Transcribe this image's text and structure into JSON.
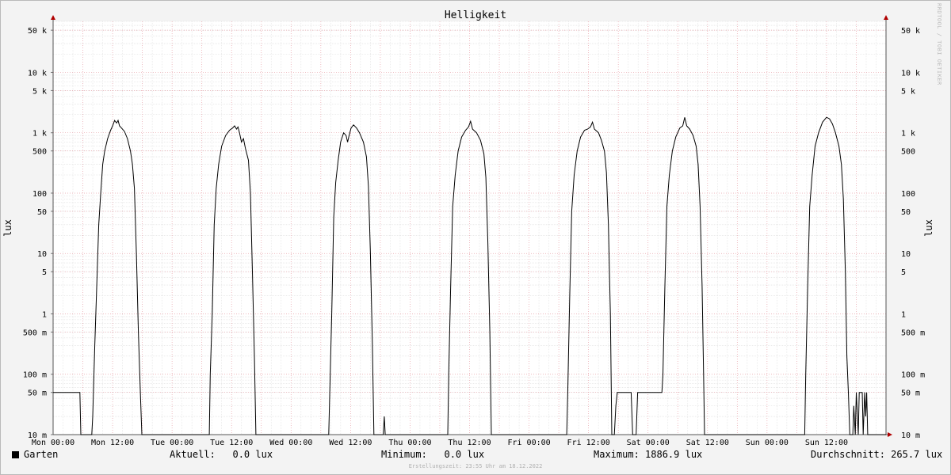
{
  "chart_data": {
    "type": "line",
    "title": "Helligkeit",
    "ylabel": "lux",
    "y_scale": "log",
    "ylim": [
      0.01,
      70000
    ],
    "y_ticks": [
      {
        "value": 0.01,
        "label": "10 m"
      },
      {
        "value": 0.05,
        "label": "50 m"
      },
      {
        "value": 0.1,
        "label": "100 m"
      },
      {
        "value": 0.5,
        "label": "500 m"
      },
      {
        "value": 1,
        "label": "1"
      },
      {
        "value": 5,
        "label": "5"
      },
      {
        "value": 10,
        "label": "10"
      },
      {
        "value": 50,
        "label": "50"
      },
      {
        "value": 100,
        "label": "100"
      },
      {
        "value": 500,
        "label": "500"
      },
      {
        "value": 1000,
        "label": "1 k"
      },
      {
        "value": 5000,
        "label": "5 k"
      },
      {
        "value": 10000,
        "label": "10 k"
      },
      {
        "value": 50000,
        "label": "50 k"
      }
    ],
    "xlim": [
      0,
      168
    ],
    "x_ticks": [
      {
        "value": 0,
        "label": "Mon 00:00"
      },
      {
        "value": 12,
        "label": "Mon 12:00"
      },
      {
        "value": 24,
        "label": "Tue 00:00"
      },
      {
        "value": 36,
        "label": "Tue 12:00"
      },
      {
        "value": 48,
        "label": "Wed 00:00"
      },
      {
        "value": 60,
        "label": "Wed 12:00"
      },
      {
        "value": 72,
        "label": "Thu 00:00"
      },
      {
        "value": 84,
        "label": "Thu 12:00"
      },
      {
        "value": 96,
        "label": "Fri 00:00"
      },
      {
        "value": 108,
        "label": "Fri 12:00"
      },
      {
        "value": 120,
        "label": "Sat 00:00"
      },
      {
        "value": 132,
        "label": "Sat 12:00"
      },
      {
        "value": 144,
        "label": "Sun 00:00"
      },
      {
        "value": 156,
        "label": "Sun 12:00"
      }
    ],
    "grid": true,
    "series": [
      {
        "name": "Garten",
        "color": "#000000",
        "points": [
          [
            0,
            0.05
          ],
          [
            5.4,
            0.05
          ],
          [
            5.6,
            0.01
          ],
          [
            7.8,
            0.01
          ],
          [
            8,
            0.02
          ],
          [
            8.4,
            0.3
          ],
          [
            8.8,
            3
          ],
          [
            9.2,
            30
          ],
          [
            9.6,
            100
          ],
          [
            10,
            300
          ],
          [
            10.4,
            500
          ],
          [
            11,
            800
          ],
          [
            11.6,
            1100
          ],
          [
            12,
            1300
          ],
          [
            12.4,
            1600
          ],
          [
            12.8,
            1450
          ],
          [
            13.1,
            1600
          ],
          [
            13.4,
            1300
          ],
          [
            13.8,
            1200
          ],
          [
            14.4,
            1050
          ],
          [
            15,
            800
          ],
          [
            15.6,
            500
          ],
          [
            16,
            300
          ],
          [
            16.4,
            120
          ],
          [
            16.8,
            10
          ],
          [
            17.2,
            0.5
          ],
          [
            17.6,
            0.05
          ],
          [
            17.9,
            0.01
          ],
          [
            31.5,
            0.01
          ],
          [
            31.7,
            0.1
          ],
          [
            32.1,
            1
          ],
          [
            32.5,
            30
          ],
          [
            32.9,
            120
          ],
          [
            33.4,
            300
          ],
          [
            34,
            600
          ],
          [
            34.8,
            900
          ],
          [
            35.6,
            1100
          ],
          [
            36.2,
            1200
          ],
          [
            36.6,
            1300
          ],
          [
            37,
            1150
          ],
          [
            37.3,
            1250
          ],
          [
            37.6,
            1000
          ],
          [
            38,
            700
          ],
          [
            38.4,
            800
          ],
          [
            38.8,
            550
          ],
          [
            39.4,
            350
          ],
          [
            39.8,
            100
          ],
          [
            40.2,
            5
          ],
          [
            40.6,
            0.2
          ],
          [
            40.9,
            0.01
          ],
          [
            55.6,
            0.01
          ],
          [
            55.8,
            0.05
          ],
          [
            56.2,
            1
          ],
          [
            56.6,
            40
          ],
          [
            57,
            150
          ],
          [
            57.5,
            350
          ],
          [
            58,
            700
          ],
          [
            58.6,
            1000
          ],
          [
            59.1,
            900
          ],
          [
            59.4,
            700
          ],
          [
            59.7,
            900
          ],
          [
            60.1,
            1200
          ],
          [
            60.6,
            1350
          ],
          [
            61.2,
            1200
          ],
          [
            61.8,
            1000
          ],
          [
            62.6,
            700
          ],
          [
            63.2,
            400
          ],
          [
            63.6,
            130
          ],
          [
            64,
            10
          ],
          [
            64.4,
            0.3
          ],
          [
            64.7,
            0.01
          ],
          [
            66.6,
            0.01
          ],
          [
            66.8,
            0.02
          ],
          [
            67,
            0.01
          ],
          [
            79.6,
            0.01
          ],
          [
            79.8,
            0.1
          ],
          [
            80.2,
            3
          ],
          [
            80.6,
            60
          ],
          [
            81.1,
            200
          ],
          [
            81.7,
            500
          ],
          [
            82.4,
            850
          ],
          [
            83.2,
            1100
          ],
          [
            83.8,
            1250
          ],
          [
            84.2,
            1550
          ],
          [
            84.6,
            1150
          ],
          [
            85.4,
            1000
          ],
          [
            86.2,
            750
          ],
          [
            86.9,
            450
          ],
          [
            87.3,
            180
          ],
          [
            87.7,
            15
          ],
          [
            88.1,
            0.5
          ],
          [
            88.4,
            0.01
          ],
          [
            103.6,
            0.01
          ],
          [
            103.8,
            0.05
          ],
          [
            104.2,
            2
          ],
          [
            104.6,
            50
          ],
          [
            105.1,
            200
          ],
          [
            105.7,
            500
          ],
          [
            106.4,
            850
          ],
          [
            107.2,
            1100
          ],
          [
            107.8,
            1150
          ],
          [
            108.4,
            1250
          ],
          [
            108.8,
            1500
          ],
          [
            109.2,
            1150
          ],
          [
            110,
            1000
          ],
          [
            110.6,
            750
          ],
          [
            111.2,
            500
          ],
          [
            111.6,
            220
          ],
          [
            112,
            30
          ],
          [
            112.4,
            1
          ],
          [
            112.7,
            0.01
          ],
          [
            113.2,
            0.01
          ],
          [
            113.5,
            0.03
          ],
          [
            113.8,
            0.05
          ],
          [
            116.6,
            0.05
          ],
          [
            116.9,
            0.01
          ],
          [
            117.6,
            0.01
          ],
          [
            117.9,
            0.05
          ],
          [
            122.8,
            0.05
          ],
          [
            123,
            0.1
          ],
          [
            123.4,
            3
          ],
          [
            123.8,
            60
          ],
          [
            124.3,
            200
          ],
          [
            124.9,
            500
          ],
          [
            125.6,
            850
          ],
          [
            126.4,
            1200
          ],
          [
            127,
            1300
          ],
          [
            127.4,
            1800
          ],
          [
            127.8,
            1300
          ],
          [
            128.4,
            1150
          ],
          [
            129.1,
            900
          ],
          [
            129.7,
            600
          ],
          [
            130.1,
            300
          ],
          [
            130.5,
            60
          ],
          [
            130.9,
            3
          ],
          [
            131.2,
            0.1
          ],
          [
            131.4,
            0.01
          ],
          [
            151.6,
            0.01
          ],
          [
            151.8,
            0.1
          ],
          [
            152.2,
            3
          ],
          [
            152.6,
            60
          ],
          [
            153.1,
            200
          ],
          [
            153.7,
            600
          ],
          [
            154.4,
            1000
          ],
          [
            155.2,
            1500
          ],
          [
            156,
            1800
          ],
          [
            156.6,
            1700
          ],
          [
            157.2,
            1400
          ],
          [
            157.8,
            1000
          ],
          [
            158.5,
            600
          ],
          [
            159,
            300
          ],
          [
            159.4,
            80
          ],
          [
            159.8,
            5
          ],
          [
            160.1,
            0.2
          ],
          [
            160.4,
            0.05
          ],
          [
            160.7,
            0.01
          ],
          [
            161.3,
            0.01
          ],
          [
            161.5,
            0.03
          ],
          [
            161.8,
            0.01
          ],
          [
            162,
            0.05
          ],
          [
            162.4,
            0.01
          ],
          [
            162.6,
            0.05
          ],
          [
            163.2,
            0.05
          ],
          [
            163.4,
            0.01
          ],
          [
            163.7,
            0.05
          ],
          [
            163.9,
            0.02
          ],
          [
            164.1,
            0.05
          ],
          [
            164.3,
            0.01
          ],
          [
            168,
            0.01
          ]
        ]
      }
    ]
  },
  "legend": {
    "series_name": "Garten",
    "current": "Aktuell:   0.0 lux",
    "minimum": "Minimum:   0.0 lux",
    "maximum": "Maximum: 1886.9 lux",
    "average": "Durchschnitt: 265.7 lux"
  },
  "footer": "Erstellungszeit: 23:55 Uhr am 18.12.2022",
  "watermark": "RRDTOOL / TOBI OETIKER"
}
